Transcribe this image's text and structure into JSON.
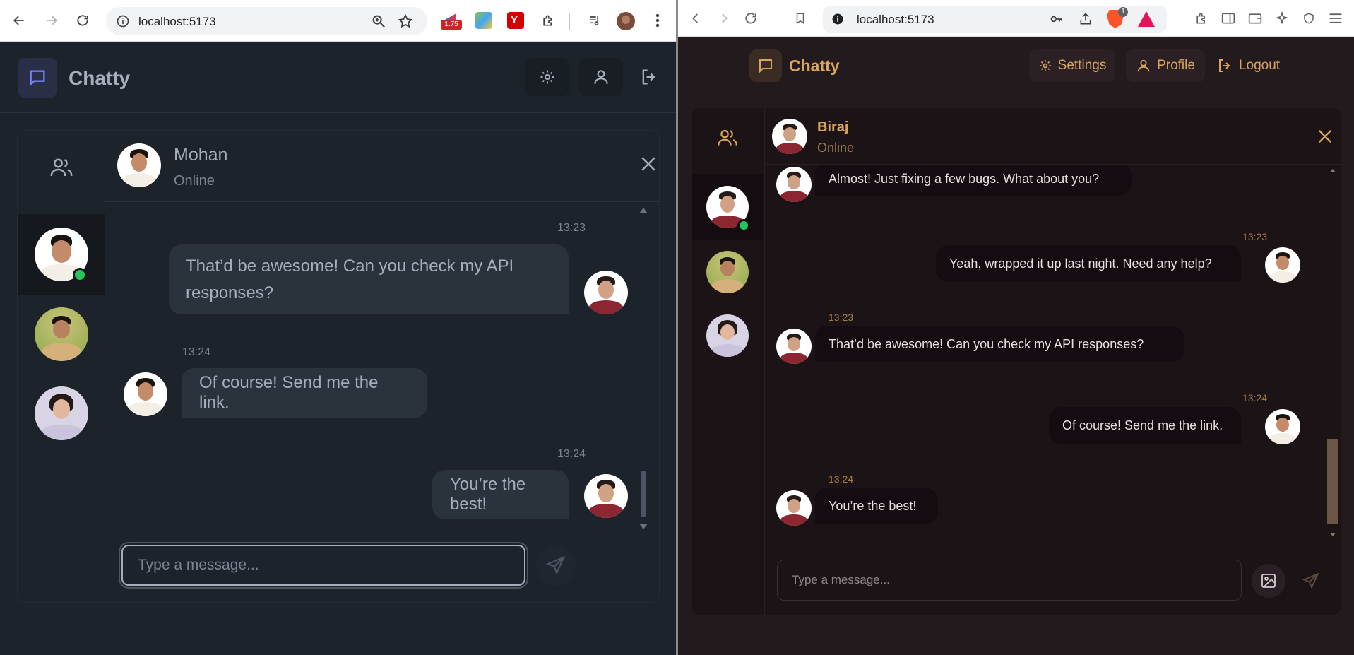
{
  "left_window": {
    "browser": {
      "url": "localhost:5173",
      "ext_badge": "1.75"
    },
    "app": {
      "brand": "Chatty"
    },
    "chat": {
      "contact_name": "Mohan",
      "contact_status": "Online",
      "messages": [
        {
          "time": "13:23",
          "text": "That’d be awesome! Can you check my API responses?",
          "side": "right"
        },
        {
          "time": "13:24",
          "text": "Of course! Send me the link.",
          "side": "left"
        },
        {
          "time": "13:24",
          "text": "You’re the best!",
          "side": "right"
        }
      ],
      "input_placeholder": "Type a message..."
    }
  },
  "right_window": {
    "browser": {
      "url": "localhost:5173",
      "shield_badge": "1"
    },
    "app": {
      "brand": "Chatty",
      "settings_label": "Settings",
      "profile_label": "Profile",
      "logout_label": "Logout"
    },
    "chat": {
      "contact_name": "Biraj",
      "contact_status": "Online",
      "messages": [
        {
          "time": "",
          "text": "Almost! Just fixing a few bugs. What about you?",
          "side": "left"
        },
        {
          "time": "13:23",
          "text": "Yeah, wrapped it up last night. Need any help?",
          "side": "right"
        },
        {
          "time": "13:23",
          "text": "That’d be awesome! Can you check my API responses?",
          "side": "left"
        },
        {
          "time": "13:24",
          "text": "Of course! Send me the link.",
          "side": "right"
        },
        {
          "time": "13:24",
          "text": "You’re the best!",
          "side": "left"
        }
      ],
      "input_placeholder": "Type a message..."
    }
  },
  "colors": {
    "left_bg": "#1d232a",
    "left_bubble": "#2a323c",
    "left_accent": "#7480ff",
    "right_bg": "#231a1e",
    "right_bubble": "#140c10",
    "right_accent": "#d9a55c",
    "online": "#22c55e"
  }
}
